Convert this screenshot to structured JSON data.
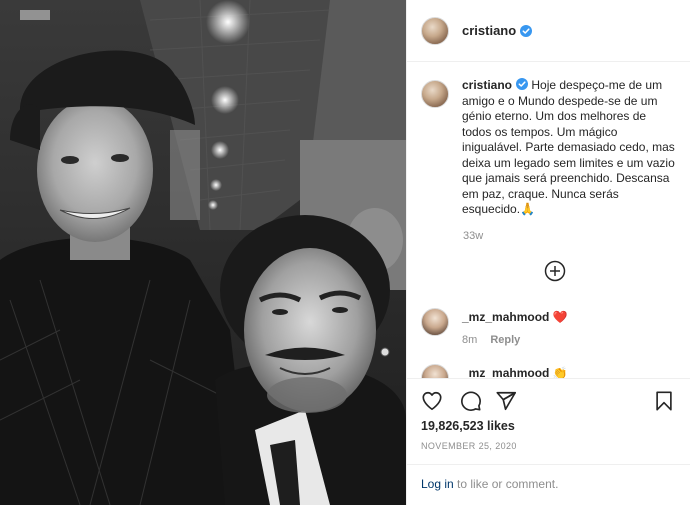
{
  "post": {
    "author": {
      "username": "cristiano",
      "verified": true
    },
    "photo": {
      "description_icon": "black-and-white-photo"
    },
    "caption": {
      "username": "cristiano",
      "text": "Hoje despeço-me de um amigo e o Mundo despede-se de um génio eterno. Um dos melhores de todos os tempos. Um mágico inigualável. Parte demasiado cedo, mas deixa um legado sem limites e um vazio que jamais será preenchido. Descansa em paz, craque. Nunca serás esquecido.🙏",
      "time_ago": "33w"
    },
    "comments": [
      {
        "username": "_mz_mahmood",
        "emoji": "❤️",
        "time": "8m",
        "reply_label": "Reply"
      },
      {
        "username": "_mz_mahmood",
        "emoji": "👏"
      }
    ],
    "likes": "19,826,523 likes",
    "date": "NOVEMBER 25, 2020",
    "login": {
      "link": "Log in",
      "rest": " to like or comment."
    }
  },
  "colors": {
    "verified": "#3897f0",
    "text": "#262626",
    "muted": "#8e8e8e",
    "link": "#00376b",
    "heart": "#ed4956"
  },
  "icons": [
    "heart-icon",
    "comment-icon",
    "share-icon",
    "bookmark-icon",
    "add-circle-icon",
    "verified-badge-icon"
  ]
}
